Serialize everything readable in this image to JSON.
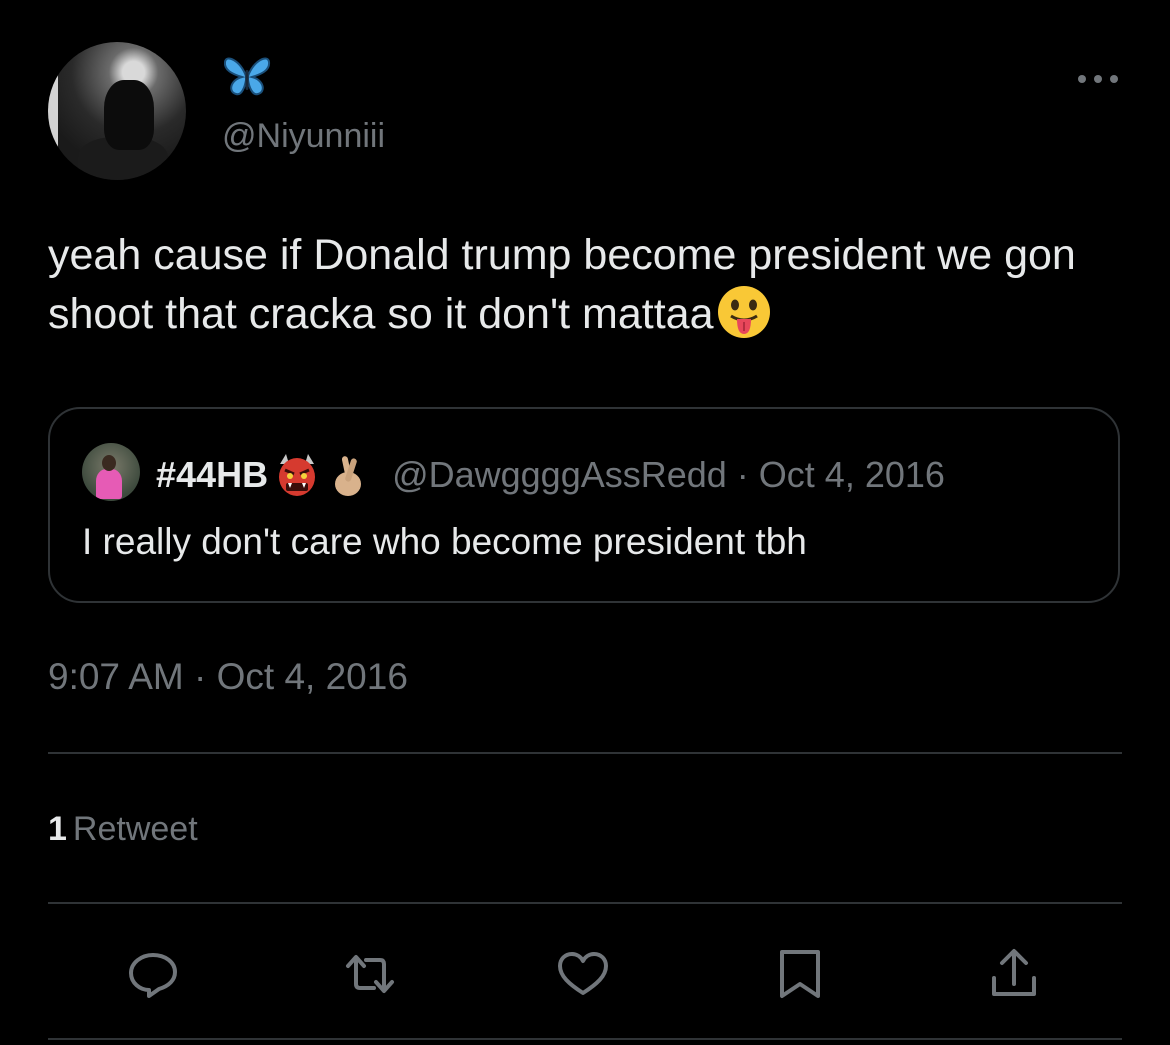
{
  "tweet": {
    "handle": "@Niyunniii",
    "text": "yeah cause if Donald trump become president we gon shoot that cracka so it don't mattaa",
    "timestamp": "9:07 AM · Oct 4, 2016"
  },
  "quoted_tweet": {
    "display_name": "#44HB",
    "handle": "@DawggggAssRedd",
    "separator": "·",
    "date": "Oct 4, 2016",
    "text": "I really don't care who become president tbh"
  },
  "stats": {
    "retweet_count": "1",
    "retweet_label": "Retweet"
  },
  "icons": {
    "name_badge": "butterfly-icon",
    "more": "more-icon",
    "text_emoji": "tongue-face-icon",
    "quote_emojis": [
      "ogre-icon",
      "crossed-fingers-icon"
    ],
    "actions": [
      "reply-icon",
      "retweet-icon",
      "like-icon",
      "bookmark-icon",
      "share-icon"
    ]
  },
  "colors": {
    "background": "#000000",
    "text": "#e7e9ea",
    "secondary": "#71767b",
    "border": "#2f3336",
    "butterfly": "#4aa8e8"
  }
}
